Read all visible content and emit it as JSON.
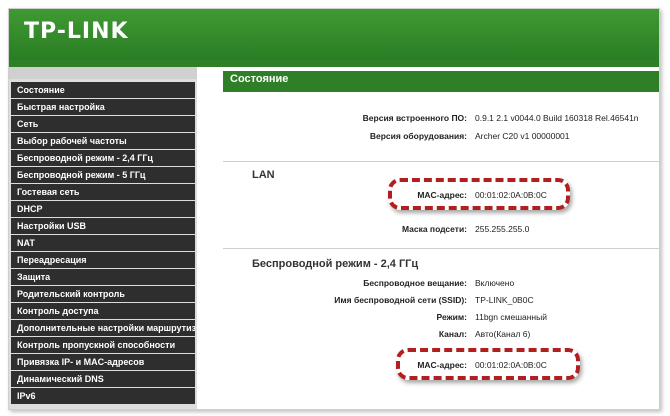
{
  "brand": {
    "logo": "TP-LINK"
  },
  "sidebar": {
    "items": [
      "Состояние",
      "Быстрая настройка",
      "Сеть",
      "Выбор рабочей частоты",
      "Беспроводной режим - 2,4 ГГц",
      "Беспроводной режим - 5 ГГц",
      "Гостевая сеть",
      "DHCP",
      "Настройки USB",
      "NAT",
      "Переадресация",
      "Защита",
      "Родительский контроль",
      "Контроль доступа",
      "Дополнительные настройки маршрутизации",
      "Контроль пропускной способности",
      "Привязка IP- и MAC-адресов",
      "Динамический DNS",
      "IPv6"
    ]
  },
  "main": {
    "section_title": "Состояние",
    "firmware_label": "Версия встроенного ПО:",
    "firmware_value": "0.9.1 2.1 v0044.0 Build 160318 Rel.46541n",
    "hardware_label": "Версия оборудования:",
    "hardware_value": "Archer C20 v1 00000001",
    "lan": {
      "title": "LAN",
      "mac_label": "MAC-адрес:",
      "mac_value": "00:01:02:0A:0B:0C",
      "mask_label": "Маска подсети:",
      "mask_value": "255.255.255.0"
    },
    "wireless": {
      "title": "Беспроводной режим - 2,4 ГГц",
      "broadcast_label": "Беспроводное вещание:",
      "broadcast_value": "Включено",
      "ssid_label": "Имя беспроводной сети (SSID):",
      "ssid_value": "TP-LINK_0B0C",
      "mode_label": "Режим:",
      "mode_value": "11bgn смешанный",
      "channel_label": "Канал:",
      "channel_value": "Авто(Канал 6)",
      "mac_label": "MAC-адрес:",
      "mac_value": "00:01:02:0A:0B:0C"
    }
  },
  "colors": {
    "header_green": "#2f7f28",
    "menu_bg": "#2e2e2e",
    "highlight": "#b21f1f"
  }
}
